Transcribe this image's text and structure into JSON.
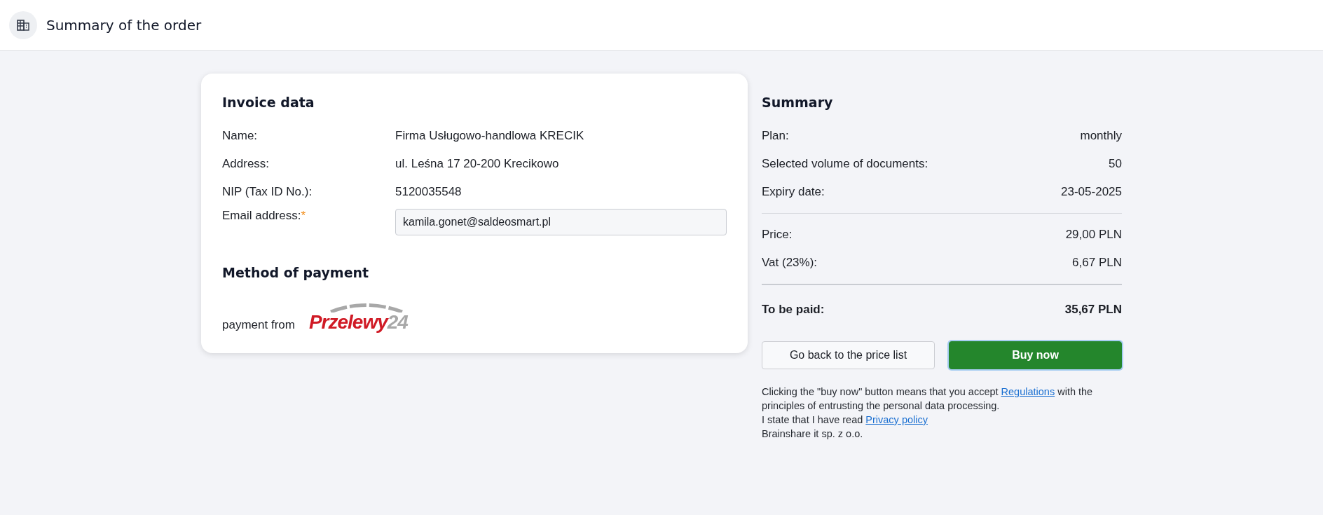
{
  "header": {
    "title": "Summary of the order"
  },
  "invoice": {
    "title": "Invoice data",
    "rows": [
      {
        "label": "Name:",
        "value": "Firma Usługowo-handlowa KRECIK"
      },
      {
        "label": "Address:",
        "value": "ul. Leśna 17 20-200 Krecikowo"
      },
      {
        "label": "NIP (Tax ID No.):",
        "value": "5120035548"
      }
    ],
    "email": {
      "label": "Email address:",
      "required_mark": "*",
      "value": "kamila.gonet@saldeosmart.pl"
    }
  },
  "payment": {
    "title": "Method of payment",
    "text": "payment from",
    "logo": {
      "name": "Przelewy",
      "number": "24"
    }
  },
  "summary": {
    "title": "Summary",
    "details": [
      {
        "label": "Plan:",
        "value": "monthly"
      },
      {
        "label": "Selected volume of documents:",
        "value": "50"
      },
      {
        "label": "Expiry date:",
        "value": "23-05-2025"
      }
    ],
    "costs": [
      {
        "label": "Price:",
        "value": "29,00 PLN"
      },
      {
        "label": "Vat (23%):",
        "value": "6,67 PLN"
      }
    ],
    "total": {
      "label": "To be paid:",
      "value": "35,67 PLN"
    },
    "buttons": [
      {
        "label": "Go back to the price list",
        "kind": "secondary"
      },
      {
        "label": "Buy now",
        "kind": "primary"
      }
    ],
    "legal": [
      {
        "before": "Clicking the \"buy now\" button means that you accept ",
        "link": "Regulations",
        "after": " with the principles of entrusting the personal data processing."
      },
      {
        "before": "I state that I have read ",
        "link": "Privacy policy"
      },
      {
        "before": "Brainshare it sp. z o.o."
      }
    ]
  }
}
